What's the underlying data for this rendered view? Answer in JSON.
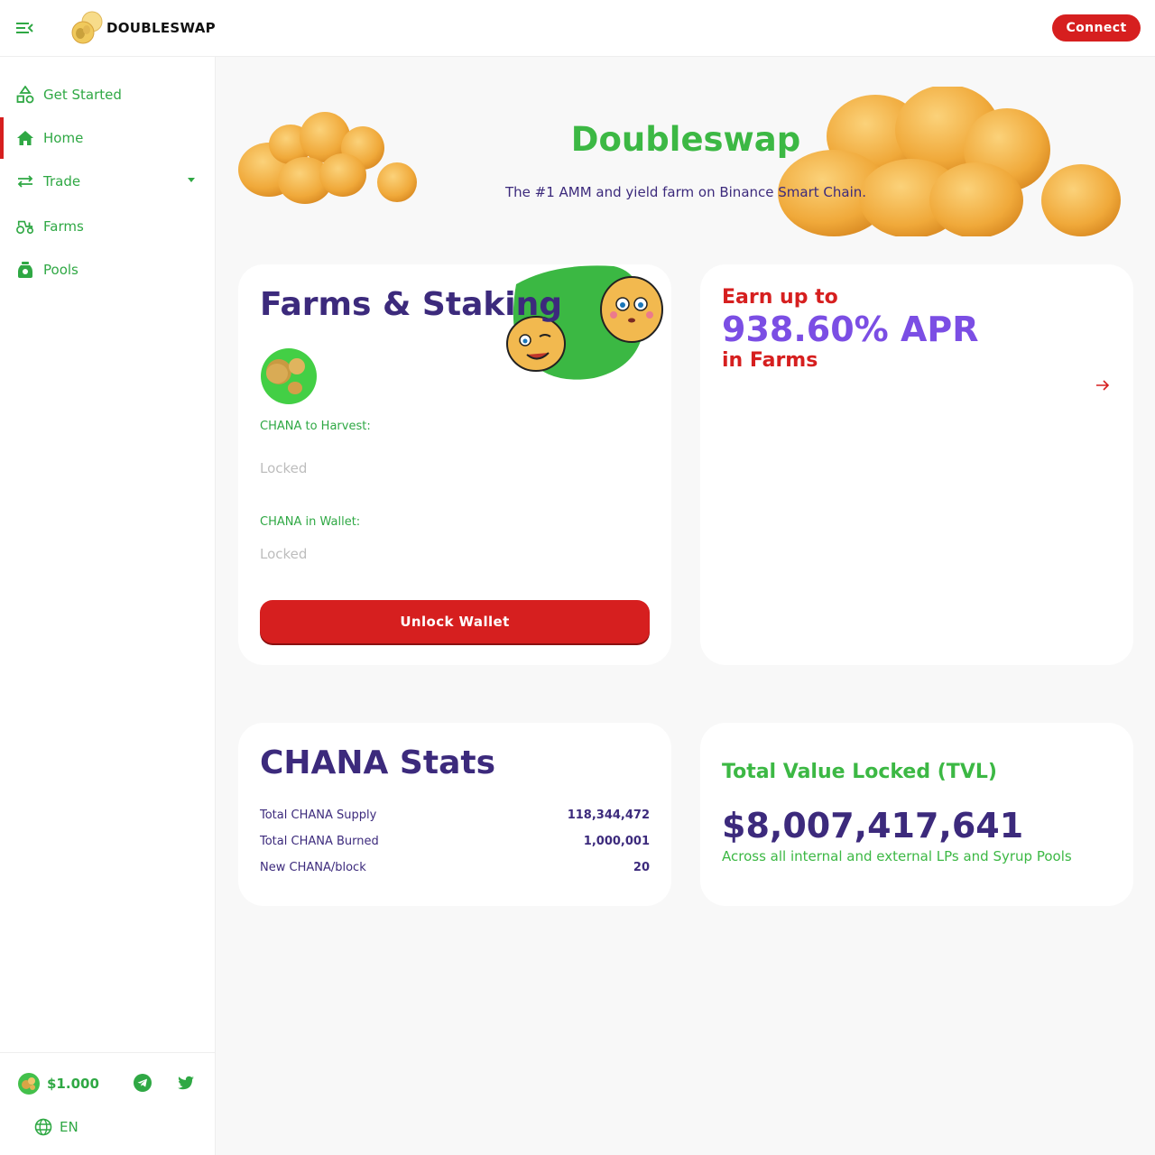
{
  "header": {
    "brand": "DOUBLESWAP",
    "connect_label": "Connect"
  },
  "sidebar": {
    "items": [
      {
        "label": "Get Started",
        "icon": "shapes-icon"
      },
      {
        "label": "Home",
        "icon": "home-icon",
        "active": true
      },
      {
        "label": "Trade",
        "icon": "swap-icon",
        "has_dropdown": true
      },
      {
        "label": "Farms",
        "icon": "tractor-icon"
      },
      {
        "label": "Pools",
        "icon": "honeypot-icon"
      }
    ],
    "footer": {
      "price": "$1.000",
      "language": "EN"
    }
  },
  "hero": {
    "title": "Doubleswap",
    "subtitle": "The #1 AMM and yield farm on Binance Smart Chain."
  },
  "farms_card": {
    "title": "Farms & Staking",
    "harvest_label": "CHANA to Harvest:",
    "harvest_value": "Locked",
    "wallet_label": "CHANA in Wallet:",
    "wallet_value": "Locked",
    "unlock_label": "Unlock Wallet"
  },
  "earn_card": {
    "line1": "Earn up to",
    "apr": "938.60% APR",
    "line2": "in Farms"
  },
  "stats_card": {
    "title": "CHANA Stats",
    "rows": [
      {
        "label": "Total CHANA Supply",
        "value": "118,344,472"
      },
      {
        "label": "Total CHANA Burned",
        "value": "1,000,001"
      },
      {
        "label": "New CHANA/block",
        "value": "20"
      }
    ]
  },
  "tvl_card": {
    "title": "Total Value Locked (TVL)",
    "value": "$8,007,417,641",
    "subtitle": "Across all internal and external LPs and Syrup Pools"
  },
  "colors": {
    "brand_green": "#3cb844",
    "brand_red": "#d61f1f",
    "brand_purple": "#3c2a7c",
    "apr_purple": "#7b4ee4"
  }
}
